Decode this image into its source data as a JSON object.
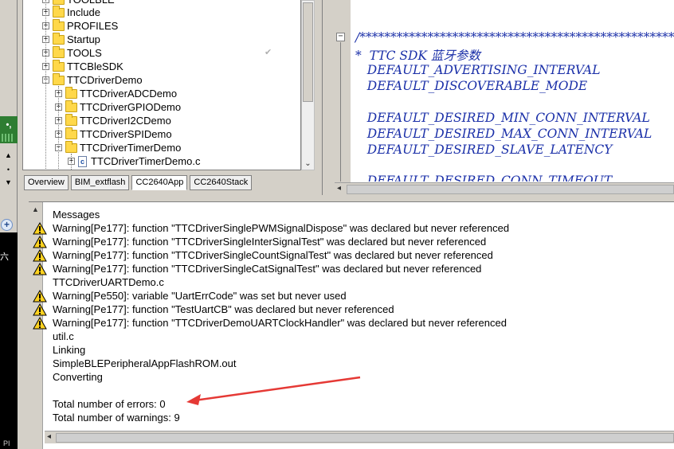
{
  "workspace": {
    "tree": [
      {
        "label": "Include",
        "type": "folder",
        "expander": "+"
      },
      {
        "label": "PROFILES",
        "type": "folder",
        "expander": "+"
      },
      {
        "label": "Startup",
        "type": "folder",
        "expander": "+"
      },
      {
        "label": "TOOLS",
        "type": "folder",
        "expander": "+"
      },
      {
        "label": "TTCBleSDK",
        "type": "folder",
        "expander": "+"
      },
      {
        "label": "TTCDriverDemo",
        "type": "folder",
        "expander": "−"
      },
      {
        "label": "TTCDriverADCDemo",
        "type": "folder",
        "expander": "+"
      },
      {
        "label": "TTCDriverGPIODemo",
        "type": "folder",
        "expander": "+"
      },
      {
        "label": "TTCDriverI2CDemo",
        "type": "folder",
        "expander": "+"
      },
      {
        "label": "TTCDriverSPIDemo",
        "type": "folder",
        "expander": "+"
      },
      {
        "label": "TTCDriverTimerDemo",
        "type": "folder",
        "expander": "−"
      },
      {
        "label": "TTCDriverTimerDemo.c",
        "type": "file",
        "expander": "+"
      }
    ],
    "tabs": [
      "Overview",
      "BIM_extflash",
      "CC2640App",
      "CC2640Stack"
    ],
    "active_tab": "CC2640App"
  },
  "editor": {
    "lines": [
      "/*****************************************************",
      "*  TTC SDK 蓝牙参数",
      "   DEFAULT_ADVERTISING_INTERVAL",
      "   DEFAULT_DISCOVERABLE_MODE",
      "",
      "   DEFAULT_DESIRED_MIN_CONN_INTERVAL",
      "   DEFAULT_DESIRED_MAX_CONN_INTERVAL",
      "   DEFAULT_DESIRED_SLAVE_LATENCY",
      "",
      "   DEFAULT_DESIRED_CONN_TIMEOUT"
    ]
  },
  "messages": {
    "lines": [
      {
        "text": "Messages",
        "warn": false
      },
      {
        "text": "Warning[Pe177]: function \"TTCDriverSinglePWMSignalDispose\" was declared but never referenced",
        "warn": true
      },
      {
        "text": "Warning[Pe177]: function \"TTCDriverSingleInterSignalTest\" was declared but never referenced",
        "warn": true
      },
      {
        "text": "Warning[Pe177]: function \"TTCDriverSingleCountSignalTest\" was declared but never referenced",
        "warn": true
      },
      {
        "text": "Warning[Pe177]: function \"TTCDriverSingleCatSignalTest\" was declared but never referenced",
        "warn": true
      },
      {
        "text": "TTCDriverUARTDemo.c",
        "warn": false
      },
      {
        "text": "Warning[Pe550]: variable \"UartErrCode\" was set but never used",
        "warn": true
      },
      {
        "text": "Warning[Pe177]: function \"TestUartCB\" was declared but never referenced",
        "warn": true
      },
      {
        "text": "Warning[Pe177]: function \"TTCDriverDemoUARTClockHandler\" was declared but never referenced",
        "warn": true
      },
      {
        "text": "util.c",
        "warn": false
      },
      {
        "text": "Linking",
        "warn": false
      },
      {
        "text": "SimpleBLEPeripheralAppFlashROM.out",
        "warn": false
      },
      {
        "text": "Converting",
        "warn": false
      },
      {
        "text": "",
        "warn": false
      },
      {
        "text": "Total number of errors: 0",
        "warn": false
      },
      {
        "text": "Total number of warnings: 9",
        "warn": false
      }
    ]
  },
  "colors": {
    "code_text": "#1a2fa8",
    "annotation_arrow": "#e53935",
    "warning_icon": "#ffd21f"
  },
  "icons": {
    "warning": "warning-triangle-icon",
    "folder": "folder-icon",
    "file": "c-file-icon"
  }
}
